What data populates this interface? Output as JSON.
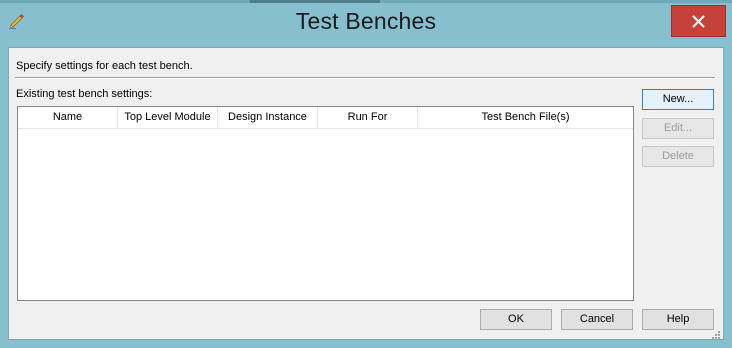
{
  "window": {
    "title": "Test Benches"
  },
  "dialog": {
    "description": "Specify settings for each test bench.",
    "list_label": "Existing test bench settings:",
    "columns": [
      "Name",
      "Top Level Module",
      "Design Instance",
      "Run For",
      "Test Bench File(s)"
    ],
    "rows": []
  },
  "side_buttons": {
    "new_label": "New...",
    "edit_label": "Edit...",
    "delete_label": "Delete"
  },
  "bottom_buttons": {
    "ok_label": "OK",
    "cancel_label": "Cancel",
    "help_label": "Help"
  },
  "colors": {
    "frame": "#86c0cf",
    "close_button": "#c7413b",
    "client_background": "#f0f0f0"
  },
  "icons": {
    "app": "pencil-icon",
    "close": "close-icon",
    "resize": "resize-grip-icon"
  }
}
